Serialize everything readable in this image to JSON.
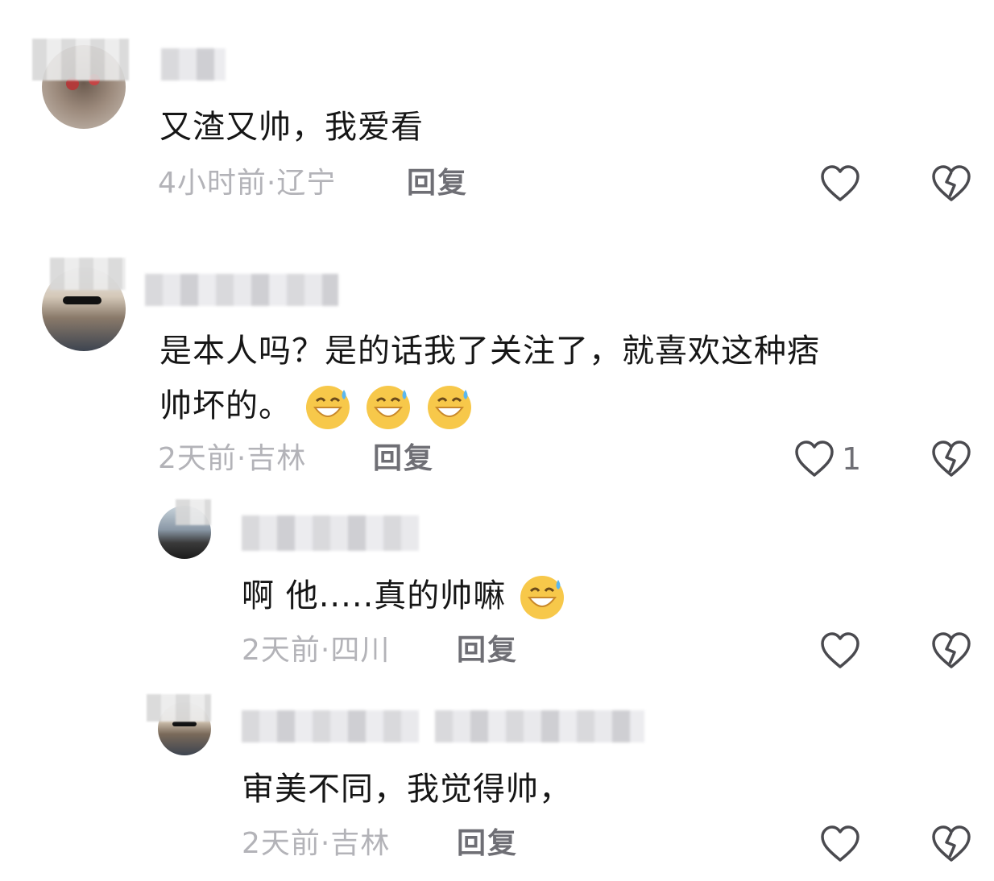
{
  "comments": [
    {
      "text": "又渣又帅，我爱看",
      "meta": "4小时前·辽宁",
      "reply_label": "回复",
      "likes": ""
    },
    {
      "text_line1": "是本人吗？是的话我了关注了，就喜欢这种痞",
      "text_line2": "帅坏的。",
      "emoji_count": 3,
      "meta": "2天前·吉林",
      "reply_label": "回复",
      "likes": "1"
    }
  ],
  "replies": [
    {
      "text": "啊 他.....真的帅嘛",
      "emoji_count": 1,
      "meta": "2天前·四川",
      "reply_label": "回复"
    },
    {
      "text": "审美不同，我觉得帅，",
      "meta": "2天前·吉林",
      "reply_label": "回复"
    }
  ],
  "icons": {
    "like": "heart-outline-icon",
    "dislike": "broken-heart-icon",
    "emoji": "grinning-sweat-emoji"
  },
  "colors": {
    "text": "#161616",
    "meta": "#b3b3b8",
    "reply": "#6f6f75",
    "icon": "#4a4a4f"
  }
}
